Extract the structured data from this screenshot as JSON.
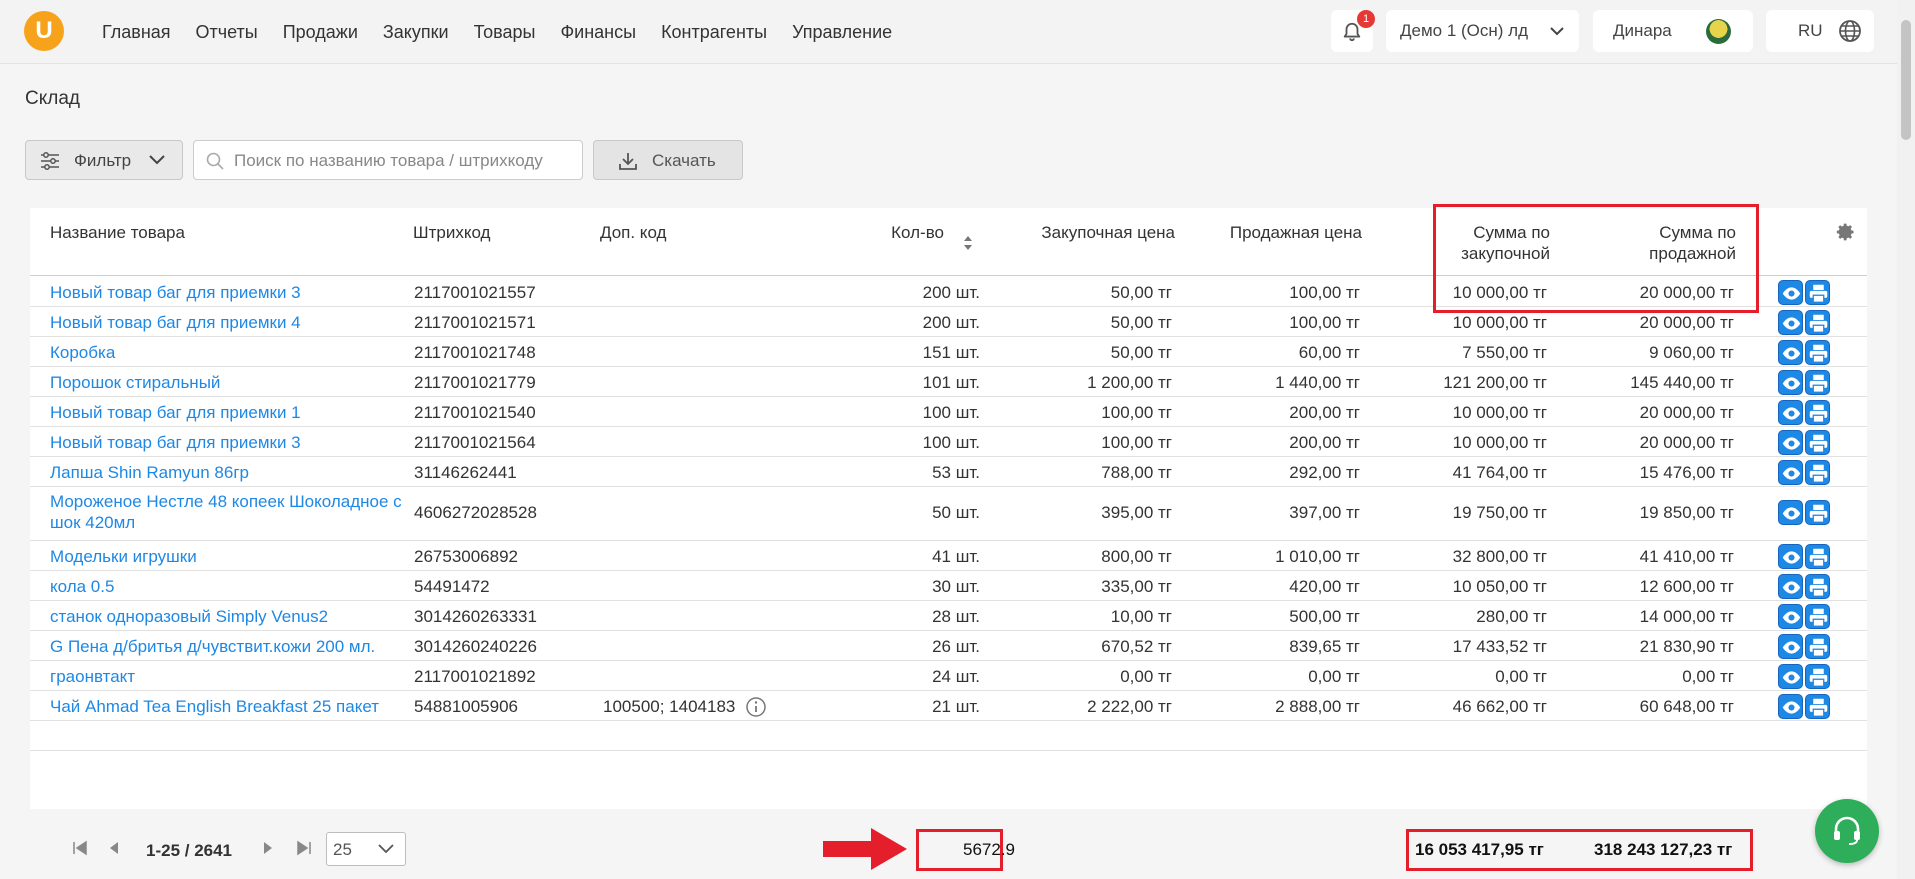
{
  "header": {
    "logo_letter": "U",
    "nav": [
      "Главная",
      "Отчеты",
      "Продажи",
      "Закупки",
      "Товары",
      "Финансы",
      "Контрагенты",
      "Управление"
    ],
    "notifications_count": "1",
    "company": "Демо 1 (Осн) лд",
    "user": "Динара",
    "language": "RU"
  },
  "page": {
    "title": "Склад",
    "filter_label": "Фильтр",
    "search_placeholder": "Поиск по названию товара / штрихкоду",
    "download_label": "Скачать"
  },
  "table": {
    "columns": {
      "name": "Название товара",
      "barcode": "Штрихкод",
      "extra_code": "Доп. код",
      "qty": "Кол-во",
      "buy_price": "Закупочная цена",
      "sell_price": "Продажная цена",
      "buy_sum_line1": "Сумма по",
      "buy_sum_line2": "закупочной",
      "sell_sum_line1": "Сумма по",
      "sell_sum_line2": "продажной"
    },
    "rows": [
      {
        "name": "Новый товар баг для приемки 3",
        "barcode": "2117001021557",
        "extra": "",
        "qty": "200 шт.",
        "buy": "50,00 тг",
        "sell": "100,00 тг",
        "buy_sum": "10 000,00 тг",
        "sell_sum": "20 000,00 тг"
      },
      {
        "name": "Новый товар баг для приемки 4",
        "barcode": "2117001021571",
        "extra": "",
        "qty": "200 шт.",
        "buy": "50,00 тг",
        "sell": "100,00 тг",
        "buy_sum": "10 000,00 тг",
        "sell_sum": "20 000,00 тг"
      },
      {
        "name": "Коробка",
        "barcode": "2117001021748",
        "extra": "",
        "qty": "151 шт.",
        "buy": "50,00 тг",
        "sell": "60,00 тг",
        "buy_sum": "7 550,00 тг",
        "sell_sum": "9 060,00 тг"
      },
      {
        "name": "Порошок стиральный",
        "barcode": "2117001021779",
        "extra": "",
        "qty": "101 шт.",
        "buy": "1 200,00 тг",
        "sell": "1 440,00 тг",
        "buy_sum": "121 200,00 тг",
        "sell_sum": "145 440,00 тг"
      },
      {
        "name": "Новый товар баг для приемки 1",
        "barcode": "2117001021540",
        "extra": "",
        "qty": "100 шт.",
        "buy": "100,00 тг",
        "sell": "200,00 тг",
        "buy_sum": "10 000,00 тг",
        "sell_sum": "20 000,00 тг"
      },
      {
        "name": "Новый товар баг для приемки 3",
        "barcode": "2117001021564",
        "extra": "",
        "qty": "100 шт.",
        "buy": "100,00 тг",
        "sell": "200,00 тг",
        "buy_sum": "10 000,00 тг",
        "sell_sum": "20 000,00 тг"
      },
      {
        "name": "Лапша Shin Ramyun 86гр",
        "barcode": "31146262441",
        "extra": "",
        "qty": "53 шт.",
        "buy": "788,00 тг",
        "sell": "292,00 тг",
        "buy_sum": "41 764,00 тг",
        "sell_sum": "15 476,00 тг"
      },
      {
        "name": "Мороженое Нестле 48 копеек Шоколадное с шок 420мл",
        "barcode": "4606272028528",
        "extra": "",
        "qty": "50 шт.",
        "buy": "395,00 тг",
        "sell": "397,00 тг",
        "buy_sum": "19 750,00 тг",
        "sell_sum": "19 850,00 тг"
      },
      {
        "name": "Модельки игрушки",
        "barcode": "26753006892",
        "extra": "",
        "qty": "41 шт.",
        "buy": "800,00 тг",
        "sell": "1 010,00 тг",
        "buy_sum": "32 800,00 тг",
        "sell_sum": "41 410,00 тг"
      },
      {
        "name": "кола 0.5",
        "barcode": "54491472",
        "extra": "",
        "qty": "30 шт.",
        "buy": "335,00 тг",
        "sell": "420,00 тг",
        "buy_sum": "10 050,00 тг",
        "sell_sum": "12 600,00 тг"
      },
      {
        "name": "станок одноразовый Simply Venus2",
        "barcode": "3014260263331",
        "extra": "",
        "qty": "28 шт.",
        "buy": "10,00 тг",
        "sell": "500,00 тг",
        "buy_sum": "280,00 тг",
        "sell_sum": "14 000,00 тг"
      },
      {
        "name": "G Пена д/бритья д/чувствит.кожи 200 мл.",
        "barcode": "3014260240226",
        "extra": "",
        "qty": "26 шт.",
        "buy": "670,52 тг",
        "sell": "839,65 тг",
        "buy_sum": "17 433,52 тг",
        "sell_sum": "21 830,90 тг"
      },
      {
        "name": "граонвтакт",
        "barcode": "2117001021892",
        "extra": "",
        "qty": "24 шт.",
        "buy": "0,00 тг",
        "sell": "0,00 тг",
        "buy_sum": "0,00 тг",
        "sell_sum": "0,00 тг"
      },
      {
        "name": "Чай Ahmad Tea English Breakfast 25 пакет",
        "barcode": "54881005906",
        "extra": "100500; 1404183",
        "qty": "21 шт.",
        "buy": "2 222,00 тг",
        "sell": "2 888,00 тг",
        "buy_sum": "46 662,00 тг",
        "sell_sum": "60 648,00 тг"
      }
    ]
  },
  "footer": {
    "range": "1-25 / 2641",
    "per_page": "25",
    "total_qty": "5672.9",
    "total_buy": "16 053 417,95 тг",
    "total_sell": "318 243 127,23 тг"
  },
  "colors": {
    "accent": "#1e88e5",
    "highlight": "#e41e2b",
    "logo": "#f6a21a",
    "support": "#2eae5a"
  }
}
